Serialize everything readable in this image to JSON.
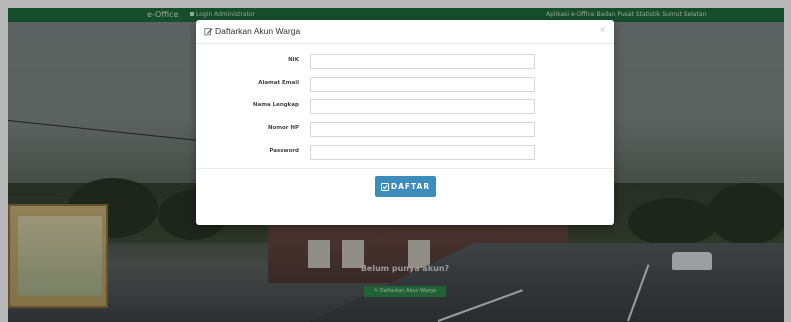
{
  "navbar": {
    "brand": "e-Office",
    "link": "Login Administrator",
    "right_text": "Aplikasi e-Office Badan Pusat Statistik Sumut Selatan"
  },
  "modal": {
    "title": "Daftarkan Akun Warga",
    "close_glyph": "×",
    "fields": [
      {
        "label": "NIK",
        "value": "",
        "placeholder": ""
      },
      {
        "label": "Alamat Email",
        "value": "",
        "placeholder": ""
      },
      {
        "label": "Nama Lengkap",
        "value": "",
        "placeholder": ""
      },
      {
        "label": "Nomor HP",
        "value": "",
        "placeholder": ""
      },
      {
        "label": "Password",
        "value": "",
        "placeholder": ""
      }
    ],
    "submit_label": "DAFTAR"
  },
  "below": {
    "prompt": "Belum punya akun?",
    "register_button": "Daftarkan Akun Warga"
  },
  "colors": {
    "navbar": "#1f6b3c",
    "primary_button": "#3c8dbc",
    "register_button": "#2c8a4d"
  },
  "icons": {
    "title_icon": "edit-icon",
    "submit_icon": "check-square-icon",
    "register_icon": "edit-icon",
    "nav_icon": "lock-icon"
  }
}
